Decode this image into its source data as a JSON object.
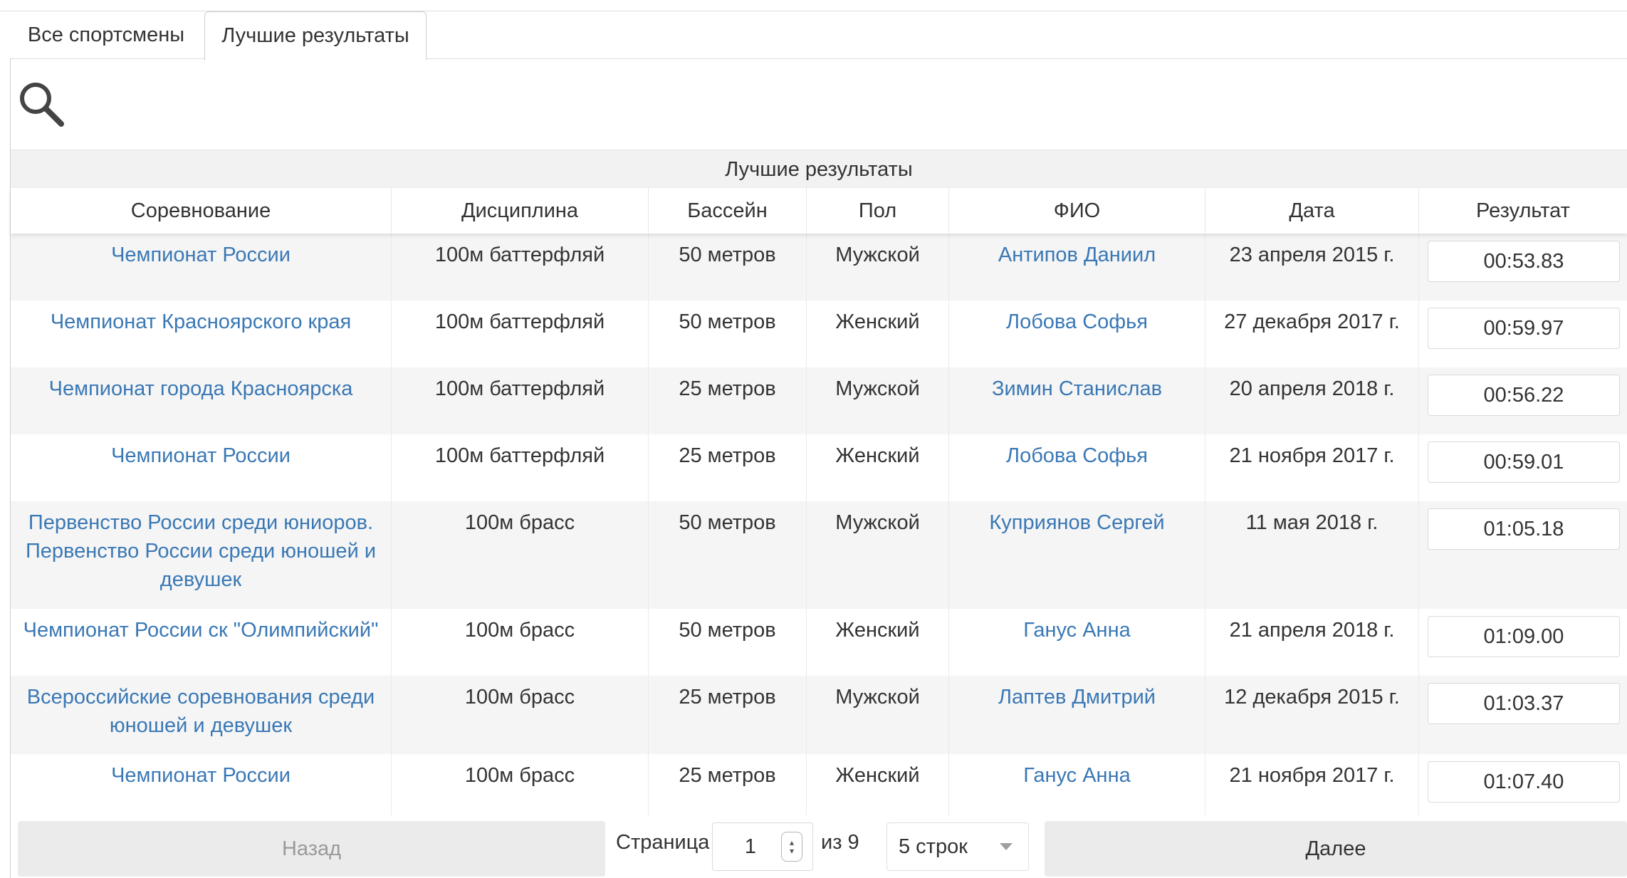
{
  "tabs": [
    {
      "label": "Все спортсмены",
      "active": false
    },
    {
      "label": "Лучшие результаты",
      "active": true
    }
  ],
  "search": {
    "icon": "search-icon"
  },
  "table": {
    "caption": "Лучшие результаты",
    "columns": [
      "Соревнование",
      "Дисциплина",
      "Бассейн",
      "Пол",
      "ФИО",
      "Дата",
      "Результат"
    ],
    "rows": [
      {
        "competition": "Чемпионат России",
        "discipline": "100м баттерфляй",
        "pool": "50 метров",
        "gender": "Мужской",
        "name": "Антипов Даниил",
        "date": "23 апреля 2015 г.",
        "result": "00:53.83"
      },
      {
        "competition": "Чемпионат Красноярского края",
        "discipline": "100м баттерфляй",
        "pool": "50 метров",
        "gender": "Женский",
        "name": "Лобова Софья",
        "date": "27 декабря 2017 г.",
        "result": "00:59.97"
      },
      {
        "competition": "Чемпионат города Красноярска",
        "discipline": "100м баттерфляй",
        "pool": "25 метров",
        "gender": "Мужской",
        "name": "Зимин Станислав",
        "date": "20 апреля 2018 г.",
        "result": "00:56.22"
      },
      {
        "competition": "Чемпионат России",
        "discipline": "100м баттерфляй",
        "pool": "25 метров",
        "gender": "Женский",
        "name": "Лобова Софья",
        "date": "21 ноября 2017 г.",
        "result": "00:59.01"
      },
      {
        "competition": "Первенство России среди юниоров. Первенство России среди юношей и девушек",
        "discipline": "100м брасс",
        "pool": "50 метров",
        "gender": "Мужской",
        "name": "Куприянов Сергей",
        "date": "11 мая 2018 г.",
        "result": "01:05.18"
      },
      {
        "competition": "Чемпионат России ск \"Олимпийский\"",
        "discipline": "100м брасс",
        "pool": "50 метров",
        "gender": "Женский",
        "name": "Ганус Анна",
        "date": "21 апреля 2018 г.",
        "result": "01:09.00"
      },
      {
        "competition": "Всероссийские соревнования среди юношей и девушек",
        "discipline": "100м брасс",
        "pool": "25 метров",
        "gender": "Мужской",
        "name": "Лаптев Дмитрий",
        "date": "12 декабря 2015 г.",
        "result": "01:03.37"
      },
      {
        "competition": "Чемпионат России",
        "discipline": "100м брасс",
        "pool": "25 метров",
        "gender": "Женский",
        "name": "Ганус Анна",
        "date": "21 ноября 2017 г.",
        "result": "01:07.40"
      }
    ]
  },
  "pagination": {
    "prev_label": "Назад",
    "page_label": "Страница",
    "page_value": "1",
    "of_label": "из 9",
    "rows_select": "5 строк",
    "next_label": "Далее"
  },
  "colors": {
    "link": "#3a78b5",
    "row_alt": "#f5f5f5",
    "button_bg": "#ebebeb"
  }
}
